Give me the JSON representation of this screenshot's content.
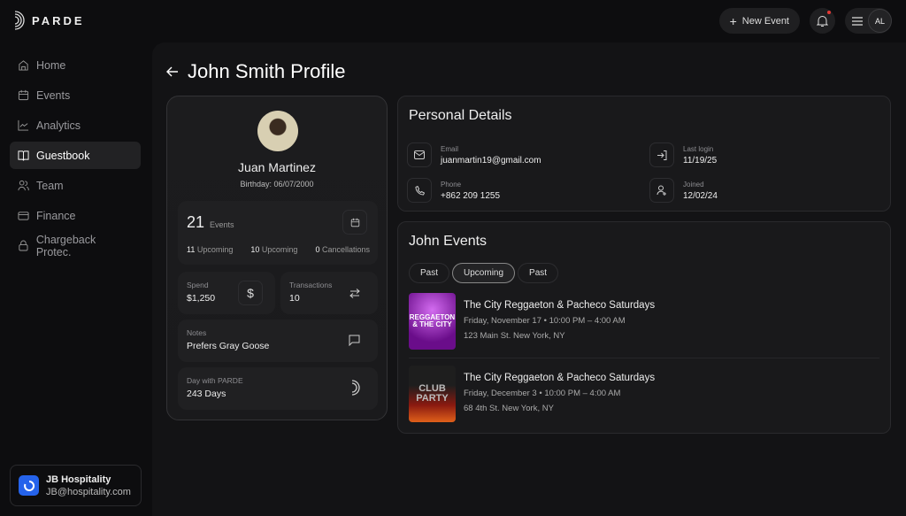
{
  "brand": {
    "name": "PARDE"
  },
  "sidebar": {
    "items": [
      {
        "label": "Home",
        "icon": "home-icon"
      },
      {
        "label": "Events",
        "icon": "calendar-icon"
      },
      {
        "label": "Analytics",
        "icon": "chart-icon"
      },
      {
        "label": "Guestbook",
        "icon": "book-icon",
        "active": true
      },
      {
        "label": "Team",
        "icon": "users-icon"
      },
      {
        "label": "Finance",
        "icon": "card-icon"
      },
      {
        "label": "Chargeback Protec.",
        "icon": "lock-icon"
      }
    ]
  },
  "org": {
    "name": "JB Hospitality",
    "email": "JB@hospitality.com"
  },
  "topbar": {
    "new_event": "New Event",
    "avatar": "AL"
  },
  "page": {
    "title": "John Smith Profile"
  },
  "profile": {
    "name": "Juan Martinez",
    "birthday": "Birthday: 06/07/2000",
    "events_count": "21",
    "events_label": "Events",
    "stats": [
      {
        "n": "11",
        "label": "Upcoming"
      },
      {
        "n": "10",
        "label": "Upcoming"
      },
      {
        "n": "0",
        "label": "Cancellations"
      }
    ],
    "spend_label": "Spend",
    "spend": "$1,250",
    "transactions_label": "Transactions",
    "transactions": "10",
    "notes_label": "Notes",
    "notes": "Prefers Gray Goose",
    "days_label": "Day with PARDE",
    "days": "243 Days"
  },
  "personal": {
    "title": "Personal Details",
    "email_label": "Email",
    "email": "juanmartin19@gmail.com",
    "phone_label": "Phone",
    "phone": "+862 209 1255",
    "login_label": "Last login",
    "login": "11/19/25",
    "joined_label": "Joined",
    "joined": "12/02/24"
  },
  "events": {
    "title": "John Events",
    "tabs": [
      "Past",
      "Upcoming",
      "Past"
    ],
    "active_tab": 1,
    "items": [
      {
        "title": "The City Reggaeton & Pacheco Saturdays",
        "when": "Friday, November 17 • 10:00 PM – 4:00 AM",
        "where": "123 Main St. New York, NY",
        "thumb_text": "REGGAETON & THE CITY"
      },
      {
        "title": "The City Reggaeton & Pacheco Saturdays",
        "when": "Friday, December 3 • 10:00 PM – 4:00 AM",
        "where": "68 4th St. New York, NY",
        "thumb_text": "CLUB PARTY"
      }
    ]
  }
}
